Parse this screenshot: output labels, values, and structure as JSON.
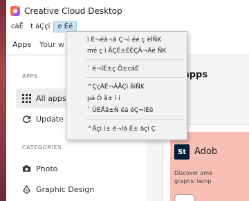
{
  "window": {
    "title": "Creative Cloud Desktop"
  },
  "menubar": {
    "items": [
      "cáË",
      "t áÇçï",
      "e Éë"
    ]
  },
  "tabs": [
    "Apps",
    "Your w"
  ],
  "sidebar": {
    "section_apps": "APPS",
    "items": [
      "All apps",
      "Update"
    ],
    "section_categories": "CATEGORIES",
    "categories": [
      "Photo",
      "Graphic Design"
    ]
  },
  "main": {
    "heading": "l apps",
    "card": {
      "logo": "St",
      "title": "Adob",
      "desc_line1": "Discover ama",
      "desc_line2": "graphic temp"
    }
  },
  "dropdown": {
    "items": [
      "ì É¬éã¬ã Ç¬ì éé ç ëÌÑK",
      "mé ç ì ÃÇÉ±ÉÉÇÃ¬Âë ÑK",
      "` é¬íÉ±ç Ö±cáÉ",
      "^ÇçÄÉ¬ÂÅÇì åíÑK",
      "pá Ö å± ì í",
      "` ÜÉÅä±Ñ ëá éÇ¬íÉë",
      "^Äçì í± é¬íá É± äçì Ç"
    ]
  },
  "colors": {
    "accent_menu_active": "#cce4f7",
    "card_banner": "#f8c0b4",
    "stock_logo_bg": "#001e36"
  }
}
